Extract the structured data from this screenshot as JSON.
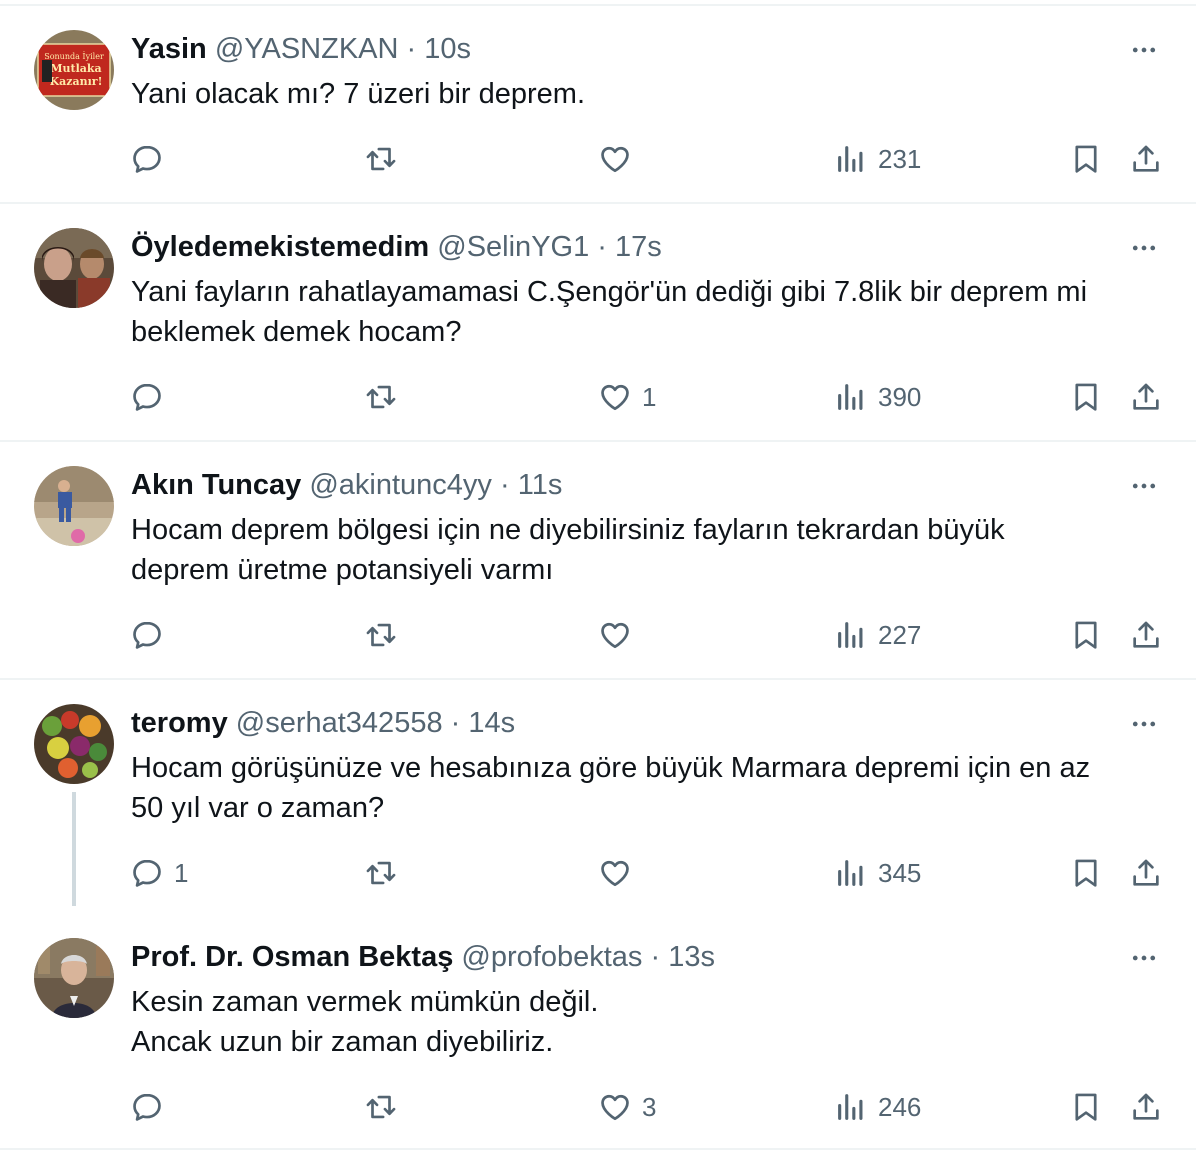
{
  "tweets": [
    {
      "name": "Yasin",
      "handle": "@YASNZKAN",
      "dot": "·",
      "time": "10s",
      "lines": [
        "Yani olacak mı? 7 üzeri bir deprem."
      ],
      "avatar_text": [
        "Sonunda İyiler",
        "Mutlaka",
        "Kazanır!"
      ],
      "replies": "",
      "retweets": "",
      "likes": "",
      "views": "231"
    },
    {
      "name": "Öyledemekistemedim",
      "handle": "@SelinYG1",
      "dot": "·",
      "time": "17s",
      "lines": [
        "Yani fayların rahatlayamamasi C.Şengör'ün dediği gibi 7.8lik bir deprem mi",
        "beklemek demek hocam?"
      ],
      "replies": "",
      "retweets": "",
      "likes": "1",
      "views": "390"
    },
    {
      "name": "Akın Tuncay",
      "handle": "@akintunc4yy",
      "dot": "·",
      "time": "11s",
      "lines": [
        "Hocam deprem bölgesi için ne diyebilirsiniz fayların tekrardan büyük",
        "deprem üretme potansiyeli varmı"
      ],
      "replies": "",
      "retweets": "",
      "likes": "",
      "views": "227"
    },
    {
      "name": "teromy",
      "handle": "@serhat342558",
      "dot": "·",
      "time": "14s",
      "lines": [
        "Hocam görüşünüze ve hesabınıza göre büyük Marmara depremi için en az",
        "50 yıl var o zaman?"
      ],
      "replies": "1",
      "retweets": "",
      "likes": "",
      "views": "345"
    },
    {
      "name": "Prof. Dr. Osman Bektaş",
      "handle": "@profobektas",
      "dot": "·",
      "time": "13s",
      "lines": [
        "Kesin zaman vermek mümkün değil.",
        "Ancak uzun bir zaman diyebiliriz."
      ],
      "replies": "",
      "retweets": "",
      "likes": "3",
      "views": "246"
    }
  ],
  "colors": {
    "text": "#0f1419",
    "secondary": "#536471",
    "divider": "#eff3f4",
    "thread_line": "#cfd9de"
  },
  "icons": [
    "reply-icon",
    "retweet-icon",
    "like-icon",
    "views-icon",
    "bookmark-icon",
    "share-icon",
    "more-icon"
  ]
}
